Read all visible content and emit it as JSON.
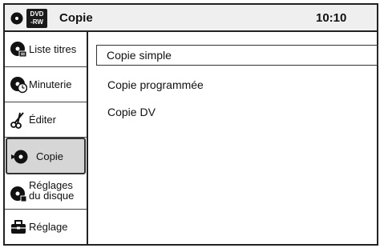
{
  "header": {
    "badge_line1": "DVD",
    "badge_line2": "-RW",
    "title": "Copie",
    "time": "10:10"
  },
  "sidebar": {
    "items": [
      {
        "label": "Liste titres",
        "icon": "title-list-icon"
      },
      {
        "label": "Minuterie",
        "icon": "timer-icon"
      },
      {
        "label": "Éditer",
        "icon": "edit-scissors-icon"
      },
      {
        "label": "Copie",
        "icon": "copy-icon",
        "selected": true
      },
      {
        "label_line1": "Réglages",
        "label_line2": "du disque",
        "icon": "disc-settings-icon"
      },
      {
        "label": "Réglage",
        "icon": "settings-toolbox-icon"
      }
    ]
  },
  "menu": {
    "items": [
      {
        "label": "Copie simple",
        "focused": true
      },
      {
        "label": "Copie programmée"
      },
      {
        "label": "Copie DV"
      }
    ]
  }
}
